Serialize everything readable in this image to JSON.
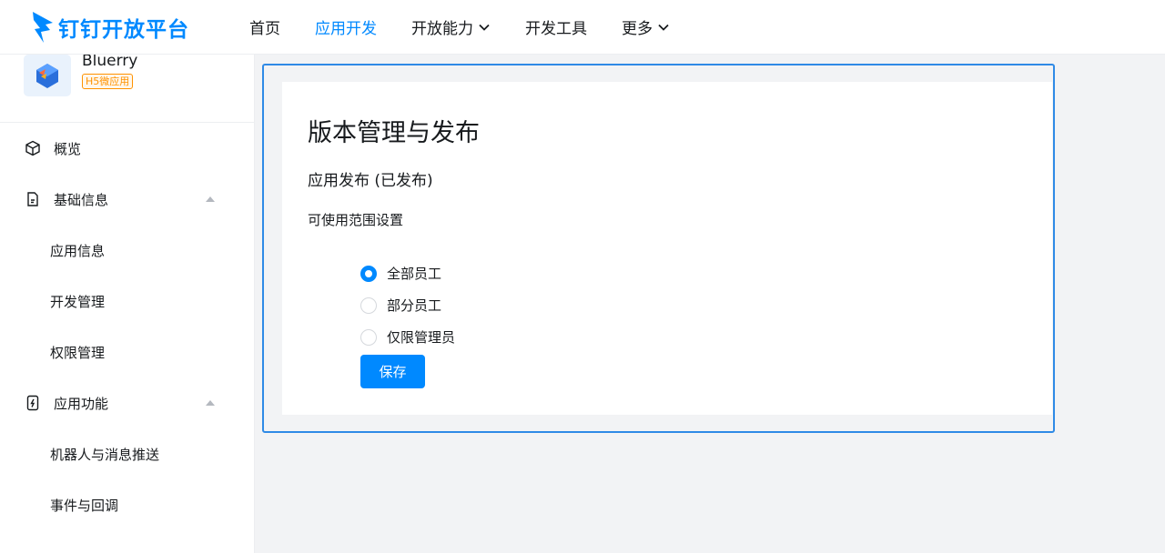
{
  "brand": {
    "name": "钉钉开放平台"
  },
  "nav": {
    "items": [
      {
        "label": "首页"
      },
      {
        "label": "应用开发"
      },
      {
        "label": "开放能力"
      },
      {
        "label": "开发工具"
      },
      {
        "label": "更多"
      }
    ],
    "active_index": 1
  },
  "app": {
    "name": "Bluerry",
    "badge": "H5微应用"
  },
  "sidebar": {
    "overview": "概览",
    "basic_info": "基础信息",
    "app_info": "应用信息",
    "dev_manage": "开发管理",
    "permission_manage": "权限管理",
    "app_features": "应用功能",
    "robot_push": "机器人与消息推送",
    "events_callback": "事件与回调"
  },
  "main": {
    "title": "版本管理与发布",
    "section_title": "应用发布 (已发布)",
    "scope_label": "可使用范围设置",
    "options": [
      {
        "label": "全部员工",
        "checked": true
      },
      {
        "label": "部分员工",
        "checked": false
      },
      {
        "label": "仅限管理员",
        "checked": false
      }
    ],
    "save_label": "保存"
  },
  "colors": {
    "accent": "#0089ff",
    "badge": "#ff9200",
    "focus_border": "#2f8ae6"
  },
  "icons": {
    "brand": "dingtalk-wing-icon",
    "overview": "cube-icon",
    "basic_info": "document-icon",
    "app_features": "phone-flash-icon",
    "dropdown": "chevron-down-icon"
  }
}
